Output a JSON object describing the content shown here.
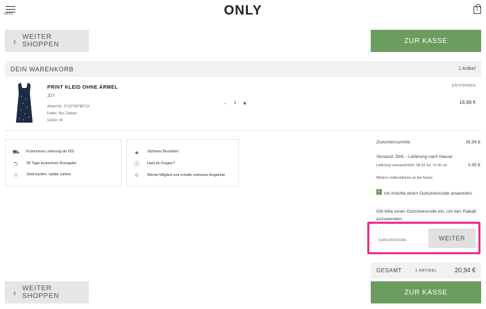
{
  "header": {
    "menu_label": "MENU",
    "logo": "ONLY",
    "bag_count": "1"
  },
  "top_buttons": {
    "continue_label": "WEITER SHOPPEN",
    "checkout_label": "ZUR KASSE"
  },
  "cart": {
    "title": "DEIN WARENKORB",
    "count": "1 Artikel"
  },
  "product": {
    "name": "PRINT KLEID OHNE ÄRMEL",
    "brand": "JDY",
    "article": "Artikel Nr.: 5713739780710",
    "color": "Farbe: Sky Captain",
    "size": "Größe: 40",
    "qty": "1",
    "qty_minus": "-",
    "qty_plus": "+",
    "remove": "ENTFERNEN",
    "price": "16,99 €"
  },
  "info_left": [
    {
      "icon": "truck-icon",
      "text": "Kostenlose Lieferung ab €50"
    },
    {
      "icon": "return-icon",
      "text": "30 Tage kostenlose Rückgabe"
    },
    {
      "icon": "star-icon",
      "text": "Jetzt kaufen, später zahlen"
    }
  ],
  "info_right": [
    {
      "icon": "lock-icon",
      "text": "Sicheres Bezahlen"
    },
    {
      "icon": "question-icon",
      "text": "Hast du Fragen?"
    },
    {
      "icon": "members-icon",
      "text": "Werde Mitglied und erhalte exklusive Angebote"
    }
  ],
  "summary": {
    "subtotal_label": "Zwischensumme",
    "subtotal_value": "16,99 €",
    "shipping_label": "Versand: DHL - Lieferung nach Hause",
    "shipping_eta": "Lieferung voraussichtlich: Mi 04 Jul - Fr 06 Jul",
    "shipping_value": "3,95 €",
    "shipping_more": "Weitere Lieferoptionen an der Kasse",
    "coupon_check_label": "ich möchte einen Gutscheincode anwenden.",
    "coupon_hint": "Gib bitte einen Gutscheincode ein, um den Rabatt anzuwenden.",
    "coupon_placeholder": "Gutscheincode",
    "coupon_button": "WEITER",
    "total_label": "GESAMT",
    "total_items": "1 ARTIKEL",
    "total_value": "20,94 €"
  },
  "bottom_buttons": {
    "continue_label": "WEITER SHOPPEN",
    "checkout_label": "ZUR KASSE"
  },
  "colors": {
    "accent_green": "#6b9e5e",
    "highlight_pink": "#e8308a",
    "bar_grey": "#f1f1f1"
  }
}
